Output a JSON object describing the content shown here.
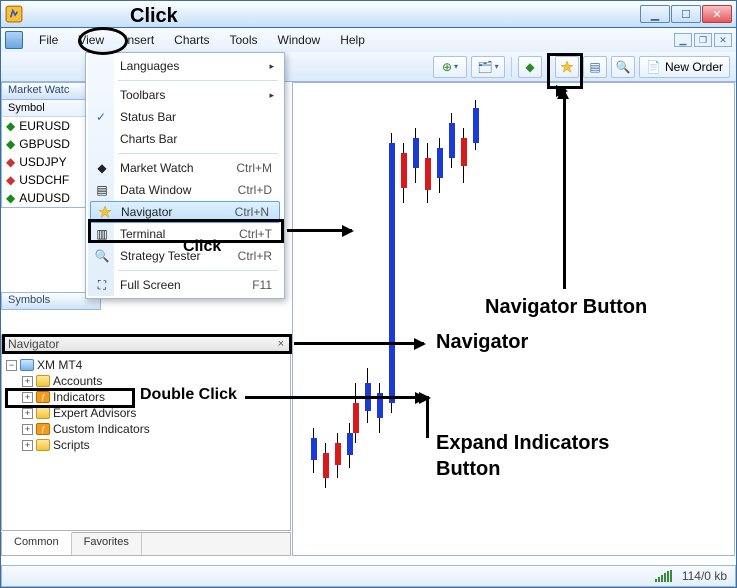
{
  "window": {
    "min_tip": "Minimize",
    "max_tip": "Maximize",
    "close_tip": "Close"
  },
  "menubar": {
    "file": "File",
    "view": "View",
    "insert": "Insert",
    "charts": "Charts",
    "tools": "Tools",
    "window": "Window",
    "help": "Help"
  },
  "toolbar": {
    "new_order": "New Order"
  },
  "view_menu": {
    "languages": "Languages",
    "toolbars": "Toolbars",
    "status_bar": "Status Bar",
    "charts_bar": "Charts Bar",
    "market_watch": "Market Watch",
    "market_watch_sc": "Ctrl+M",
    "data_window": "Data Window",
    "data_window_sc": "Ctrl+D",
    "navigator": "Navigator",
    "navigator_sc": "Ctrl+N",
    "terminal": "Terminal",
    "terminal_sc": "Ctrl+T",
    "strategy_tester": "Strategy Tester",
    "strategy_tester_sc": "Ctrl+R",
    "full_screen": "Full Screen",
    "full_screen_sc": "F11"
  },
  "market_watch": {
    "title": "Market Watc",
    "header": "Symbol",
    "rows": [
      "EURUSD",
      "GBPUSD",
      "USDJPY",
      "USDCHF",
      "AUDUSD"
    ]
  },
  "sidebar": {
    "symbols": "Symbols"
  },
  "navigator": {
    "title": "Navigator",
    "close": "×",
    "root": "XM MT4",
    "accounts": "Accounts",
    "indicators": "Indicators",
    "expert_advisors": "Expert Advisors",
    "custom_indicators": "Custom Indicators",
    "scripts": "Scripts"
  },
  "tabs": {
    "common": "Common",
    "favorites": "Favorites"
  },
  "status": {
    "speed": "114/0 kb"
  },
  "annotations": {
    "click1": "Click",
    "click2": "Click",
    "navbtn": "Navigator Button",
    "nav": "Navigator",
    "dblclick": "Double Click",
    "expand": "Expand Indicators\nButton"
  }
}
